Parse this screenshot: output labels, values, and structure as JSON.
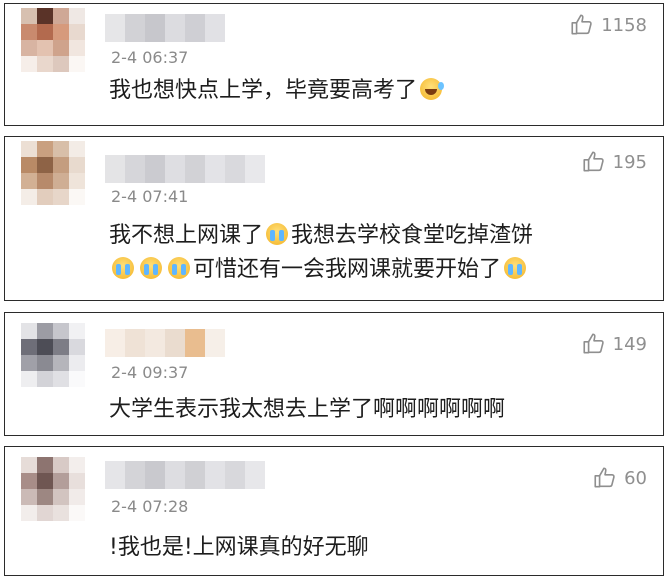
{
  "comments": [
    {
      "timestamp": "2-4 06:37",
      "likes": "1158",
      "lines": [
        [
          {
            "t": "text",
            "v": "我也想快点上学，毕竟要高考了"
          },
          {
            "t": "emoji",
            "v": "laugh"
          }
        ]
      ]
    },
    {
      "timestamp": "2-4 07:41",
      "likes": "195",
      "lines": [
        [
          {
            "t": "text",
            "v": "我不想上网课了"
          },
          {
            "t": "emoji",
            "v": "cry"
          },
          {
            "t": "text",
            "v": "我想去学校食堂吃掉渣饼"
          }
        ],
        [
          {
            "t": "emoji",
            "v": "cry"
          },
          {
            "t": "emoji",
            "v": "cry"
          },
          {
            "t": "emoji",
            "v": "cry"
          },
          {
            "t": "text",
            "v": "可惜还有一会我网课就要开始了"
          },
          {
            "t": "emoji",
            "v": "cry"
          }
        ]
      ]
    },
    {
      "timestamp": "2-4 09:37",
      "likes": "149",
      "lines": [
        [
          {
            "t": "text",
            "v": "大学生表示我太想去上学了啊啊啊啊啊啊"
          }
        ]
      ]
    },
    {
      "timestamp": "2-4 07:28",
      "likes": "60",
      "lines": [
        [
          {
            "t": "text",
            "v": "!我也是!上网课真的好无聊"
          }
        ]
      ]
    }
  ],
  "icons": {
    "like": "thumbs-up-outline-icon",
    "emoji_cry": "crying-face-icon",
    "emoji_laugh": "laughing-tears-face-icon"
  },
  "colors": {
    "border": "#2b2b2b",
    "meta_gray": "#8a8a8a",
    "text": "#1d1d1d"
  }
}
